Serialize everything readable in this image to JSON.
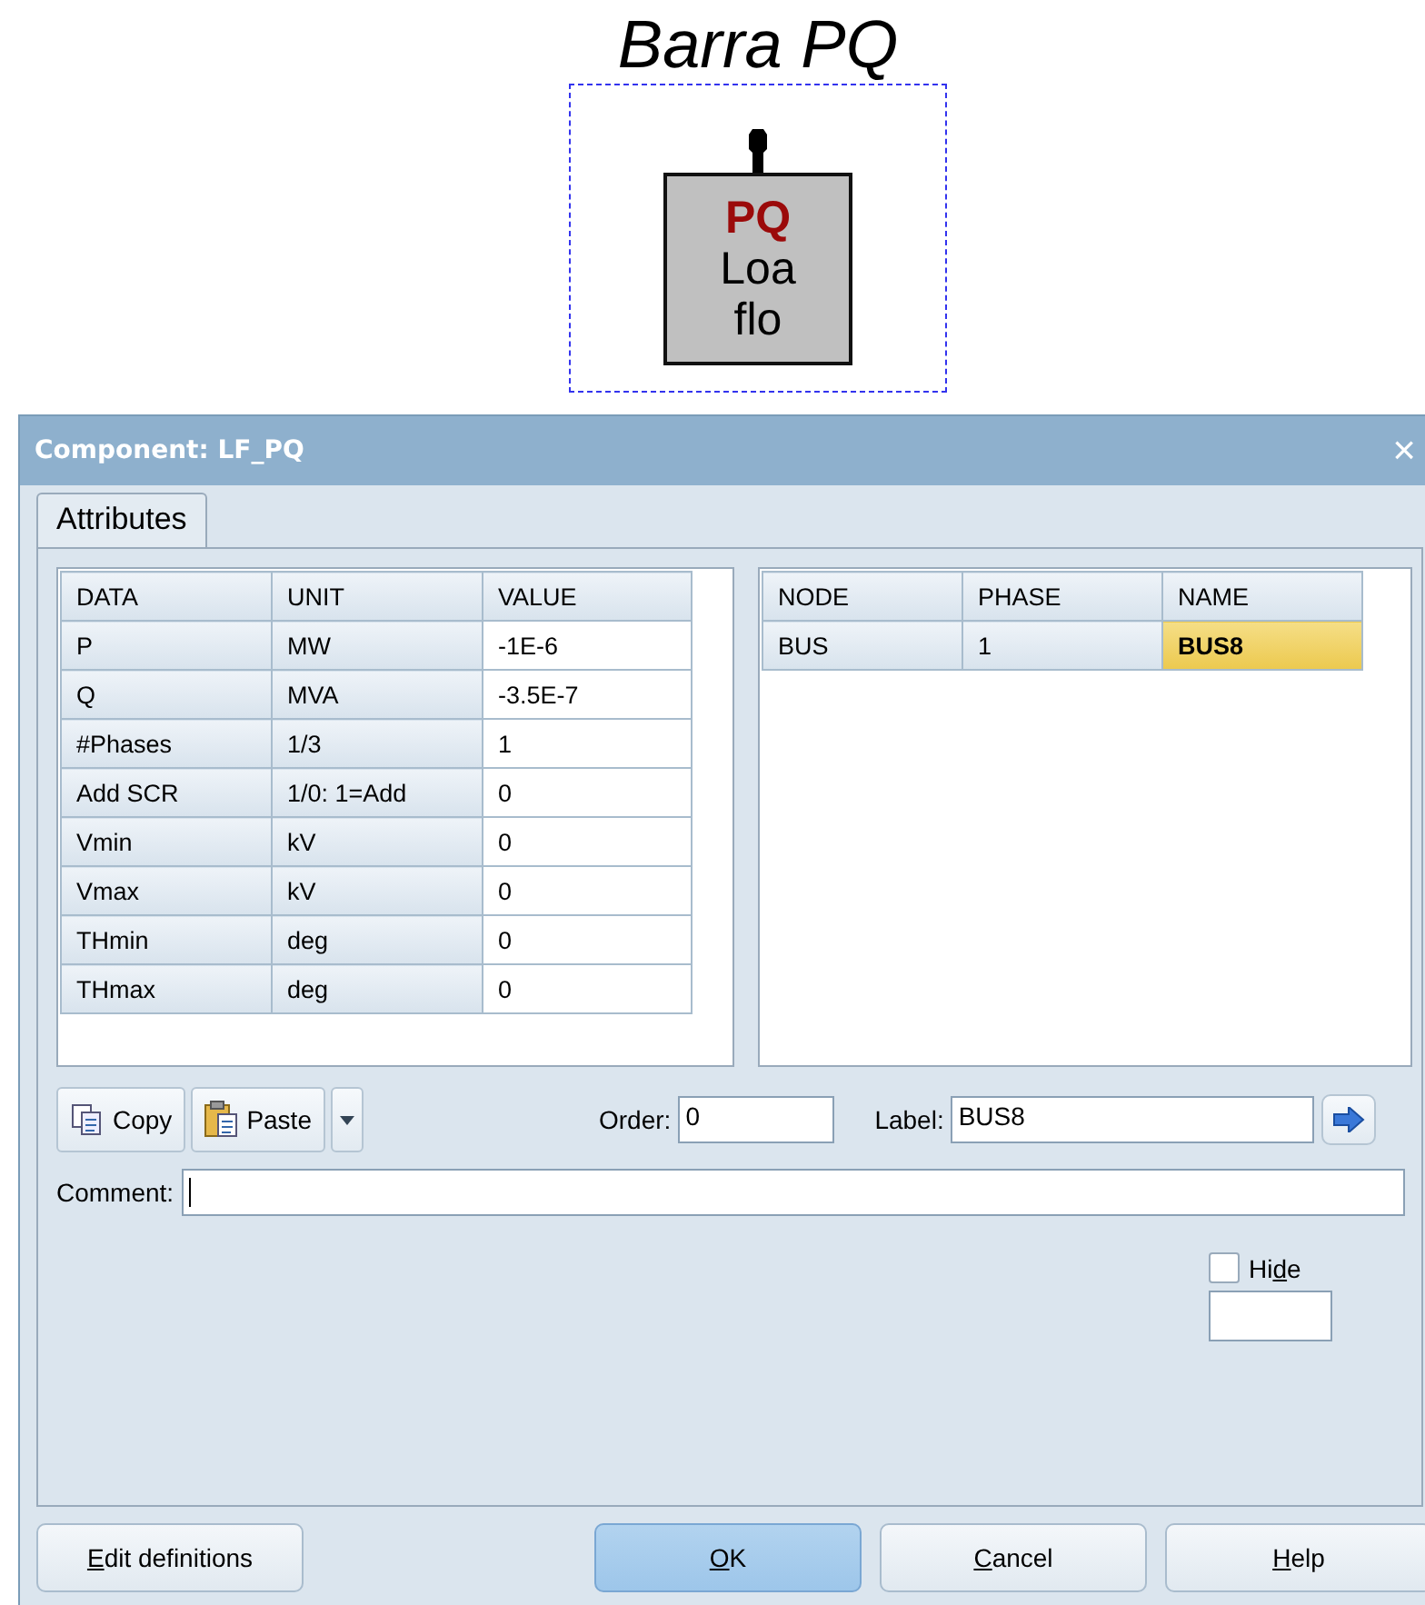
{
  "diagram": {
    "title": "Barra PQ",
    "block_lines": [
      {
        "text": "PQ",
        "kind": "tag"
      },
      {
        "text": "Loa",
        "kind": "plain"
      },
      {
        "text": "flo",
        "kind": "plain"
      }
    ]
  },
  "window": {
    "title": "Component: LF_PQ",
    "close": "×"
  },
  "tabs": [
    {
      "label": "Attributes",
      "selected": true
    }
  ],
  "data_table": {
    "columns": [
      "DATA",
      "UNIT",
      "VALUE"
    ],
    "rows": [
      {
        "cells": [
          "P",
          "MW",
          "-1E-6"
        ]
      },
      {
        "cells": [
          "Q",
          "MVA",
          "-3.5E-7"
        ]
      },
      {
        "cells": [
          "#Phases",
          "1/3",
          "1"
        ]
      },
      {
        "cells": [
          "Add SCR",
          "1/0: 1=Add",
          "0"
        ]
      },
      {
        "cells": [
          "Vmin",
          "kV",
          "0"
        ]
      },
      {
        "cells": [
          "Vmax",
          "kV",
          "0"
        ]
      },
      {
        "cells": [
          "THmin",
          "deg",
          "0"
        ]
      },
      {
        "cells": [
          "THmax",
          "deg",
          "0"
        ]
      }
    ]
  },
  "node_table": {
    "columns": [
      "NODE",
      "PHASE",
      "NAME"
    ],
    "rows": [
      {
        "cells": [
          "BUS",
          "1",
          "BUS8"
        ],
        "selected": true
      }
    ]
  },
  "tools": [
    {
      "label": "Copy",
      "kind": "copy"
    },
    {
      "label": "Paste",
      "kind": "paste"
    }
  ],
  "order": {
    "label": "Order:",
    "value": "0"
  },
  "label_field": {
    "label": "Label:",
    "value": "BUS8"
  },
  "comment": {
    "label": "Comment:",
    "focused": true
  },
  "hide": {
    "pre": "Hi",
    "key": "d",
    "post": "e",
    "checked": false
  },
  "buttons": [
    {
      "key": "E",
      "post": "dit definitions",
      "default": false
    },
    {
      "key": "O",
      "post": "K",
      "default": true
    },
    {
      "key": "C",
      "post": "ancel",
      "default": false
    },
    {
      "key": "H",
      "post": "elp",
      "default": false
    }
  ]
}
